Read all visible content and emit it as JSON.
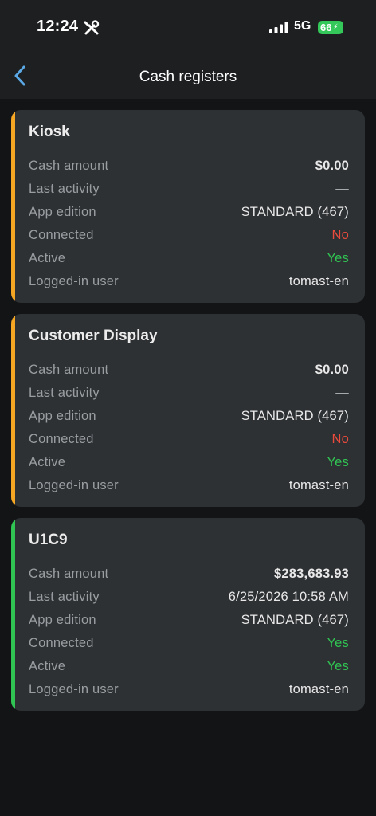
{
  "status_bar": {
    "time": "12:24",
    "network": "5G",
    "battery": "66",
    "icons": [
      "tools-icon",
      "signal-icon",
      "bolt-icon"
    ]
  },
  "nav": {
    "title": "Cash registers",
    "back_icon": "chevron-left-icon"
  },
  "colors": {
    "accent_warning": "#f5a623",
    "accent_ok": "#30c452",
    "value_no": "#ea4b3c",
    "value_yes": "#30c452"
  },
  "registers": [
    {
      "name": "Kiosk",
      "accent": "#f5a623",
      "rows": [
        {
          "label": "Cash amount",
          "value": "$0.00",
          "bold": true,
          "color": ""
        },
        {
          "label": "Last activity",
          "value": "—",
          "bold": false,
          "color": ""
        },
        {
          "label": "App edition",
          "value": "STANDARD (467)",
          "bold": false,
          "color": ""
        },
        {
          "label": "Connected",
          "value": "No",
          "bold": false,
          "color": "#ea4b3c"
        },
        {
          "label": "Active",
          "value": "Yes",
          "bold": false,
          "color": "#30c452"
        },
        {
          "label": "Logged-in user",
          "value": "tomast-en",
          "bold": false,
          "color": ""
        }
      ]
    },
    {
      "name": "Customer Display",
      "accent": "#f5a623",
      "rows": [
        {
          "label": "Cash amount",
          "value": "$0.00",
          "bold": true,
          "color": ""
        },
        {
          "label": "Last activity",
          "value": "—",
          "bold": false,
          "color": ""
        },
        {
          "label": "App edition",
          "value": "STANDARD (467)",
          "bold": false,
          "color": ""
        },
        {
          "label": "Connected",
          "value": "No",
          "bold": false,
          "color": "#ea4b3c"
        },
        {
          "label": "Active",
          "value": "Yes",
          "bold": false,
          "color": "#30c452"
        },
        {
          "label": "Logged-in user",
          "value": "tomast-en",
          "bold": false,
          "color": ""
        }
      ]
    },
    {
      "name": "U1C9",
      "accent": "#30c452",
      "rows": [
        {
          "label": "Cash amount",
          "value": "$283,683.93",
          "bold": true,
          "color": ""
        },
        {
          "label": "Last activity",
          "value": "6/25/2026 10:58 AM",
          "bold": false,
          "color": ""
        },
        {
          "label": "App edition",
          "value": "STANDARD (467)",
          "bold": false,
          "color": ""
        },
        {
          "label": "Connected",
          "value": "Yes",
          "bold": false,
          "color": "#30c452"
        },
        {
          "label": "Active",
          "value": "Yes",
          "bold": false,
          "color": "#30c452"
        },
        {
          "label": "Logged-in user",
          "value": "tomast-en",
          "bold": false,
          "color": ""
        }
      ]
    }
  ]
}
